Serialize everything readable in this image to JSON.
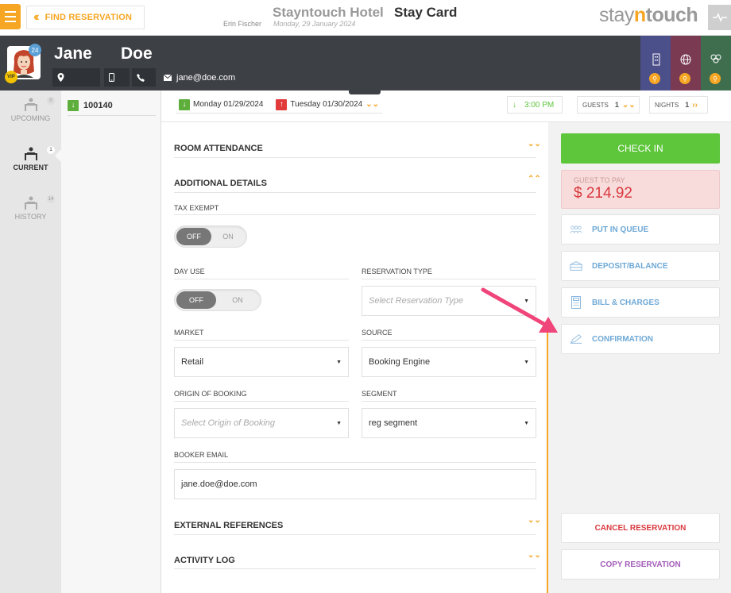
{
  "topbar": {
    "find_reservation": "FIND RESERVATION",
    "hotel_name": "Stayntouch Hotel",
    "page_title": "Stay Card",
    "user_name": "Erin Fischer",
    "business_date": "Monday, 29 January 2024",
    "logo_left": "stay",
    "logo_n": "n",
    "logo_right": "touch"
  },
  "guest": {
    "first_name": "Jane",
    "last_name": "Doe",
    "vip_badge": "VIP",
    "notification_count": "24",
    "email": "jane@doe.com",
    "icons": [
      "location-pin-icon",
      "mobile-phone-icon",
      "phone-icon",
      "envelope-icon"
    ]
  },
  "sidebar": {
    "items": [
      {
        "label": "UPCOMING",
        "count": "0"
      },
      {
        "label": "CURRENT",
        "count": "1"
      },
      {
        "label": "HISTORY",
        "count": "14"
      }
    ]
  },
  "reservation": {
    "number": "100140"
  },
  "dates": {
    "arrival": "Monday 01/29/2024",
    "departure": "Tuesday 01/30/2024",
    "arrival_time": "3:00 PM",
    "guests_label": "GUESTS",
    "guests_count": "1",
    "nights_label": "NIGHTS",
    "nights_count": "1"
  },
  "sections": {
    "room_attendance": "ROOM ATTENDANCE",
    "additional_details": "ADDITIONAL DETAILS",
    "external_references": "EXTERNAL REFERENCES",
    "activity_log": "ACTIVITY LOG"
  },
  "form": {
    "tax_exempt_label": "TAX EXEMPT",
    "day_use_label": "DAY USE",
    "toggle_off": "OFF",
    "toggle_on": "ON",
    "reservation_type_label": "RESERVATION TYPE",
    "reservation_type_placeholder": "Select Reservation Type",
    "market_label": "MARKET",
    "market_value": "Retail",
    "source_label": "SOURCE",
    "source_value": "Booking Engine",
    "origin_label": "ORIGIN OF BOOKING",
    "origin_placeholder": "Select Origin of Booking",
    "segment_label": "SEGMENT",
    "segment_value": "reg segment",
    "booker_email_label": "BOOKER EMAIL",
    "booker_email_value": "jane.doe@doe.com"
  },
  "actions": {
    "check_in": "CHECK IN",
    "guest_to_pay_label": "GUEST TO PAY",
    "guest_to_pay_amount": "$ 214.92",
    "put_in_queue": "PUT IN QUEUE",
    "deposit_balance": "DEPOSIT/BALANCE",
    "bill_charges": "BILL & CHARGES",
    "confirmation": "CONFIRMATION",
    "cancel_reservation": "CANCEL RESERVATION",
    "copy_reservation": "COPY RESERVATION"
  },
  "colors": {
    "accent": "#f6a623",
    "check_in": "#5ec63b",
    "cancel": "#d9393e",
    "copy": "#a35cb8",
    "annotation_arrow": "#f0457a"
  }
}
